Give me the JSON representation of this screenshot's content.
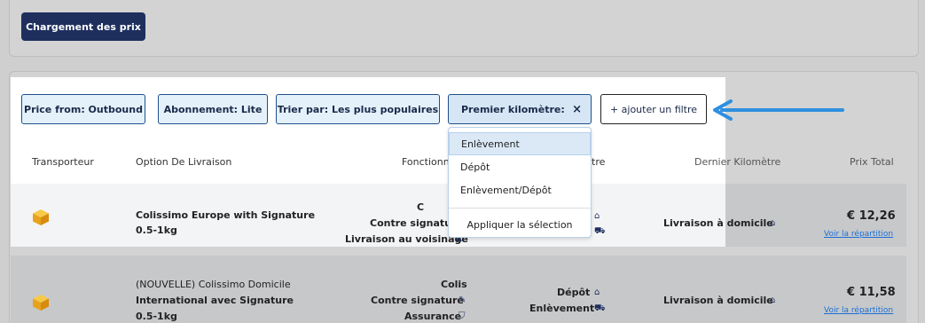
{
  "top": {
    "load_button": "Chargement des prix"
  },
  "filters": {
    "price_from": "Price from: Outbound",
    "abonnement": "Abonnement: Lite",
    "trier": "Trier par: Les plus populaires",
    "premier": "Premier kilomètre:",
    "premier_close": "×",
    "add": "+ ajouter un filtre"
  },
  "dropdown": {
    "items": [
      "Enlèvement",
      "Dépôt",
      "Enlèvement/Dépôt"
    ],
    "apply": "Appliquer la sélection"
  },
  "table": {
    "headers": {
      "transporteur": "Transporteur",
      "option": "Option De Livraison",
      "fonction": "Fonctionn",
      "premier_tail": "tre",
      "dernier": "Dernier Kilomètre",
      "prix": "Prix Total"
    },
    "rows": [
      {
        "option_line1": "Colissimo Europe with Signature",
        "option_line2": "0.5-1kg",
        "feat1": "C",
        "feat2": "Contre signature",
        "feat3": "Livraison au voisinage",
        "dernier": "Livraison à domicile",
        "price": "€ 12,26",
        "link": "Voir la répartition"
      },
      {
        "option_line1": "(NOUVELLE) Colissimo Domicile",
        "option_line2": "International avec Signature",
        "option_line3": "0.5-1kg",
        "feat1": "Colis",
        "feat2": "Contre signature",
        "feat3": "Assurance",
        "premier1": "Dépôt",
        "premier2": "Enlèvement",
        "dernier": "Livraison à domicile",
        "price": "€ 11,58",
        "link": "Voir la répartition"
      }
    ]
  },
  "colors": {
    "primary": "#1e2f5e",
    "link": "#1a6fd6",
    "arrow": "#2f8fe0",
    "chip_bg": "#e4f1fb"
  }
}
